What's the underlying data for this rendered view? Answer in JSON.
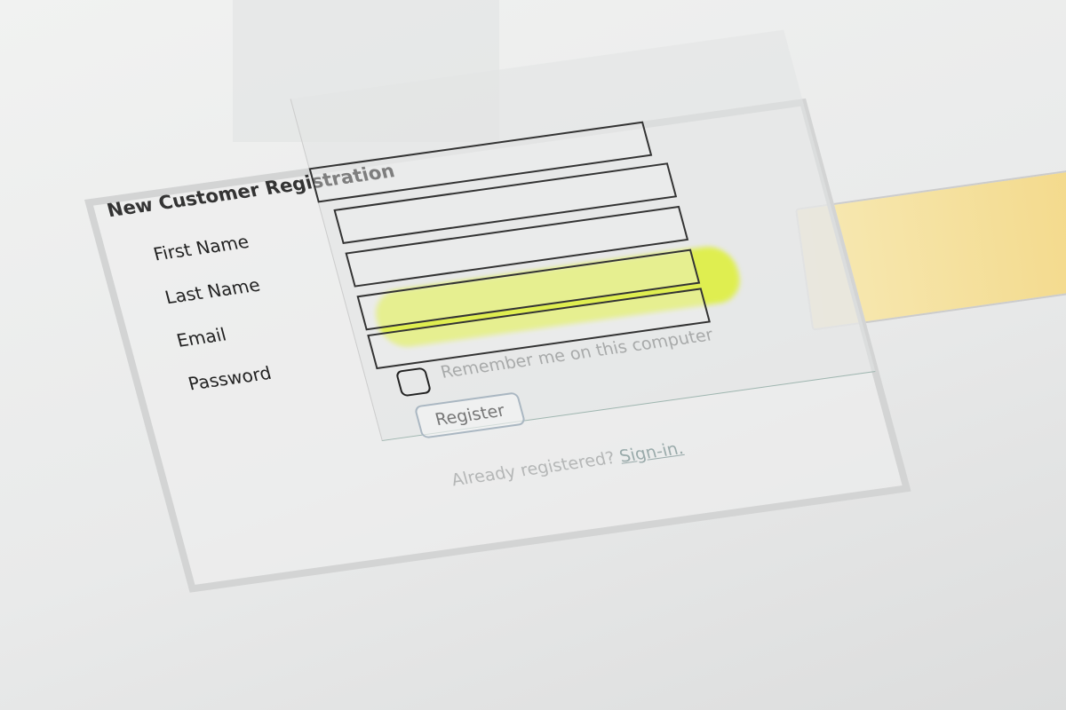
{
  "form": {
    "title": "New Customer Registration",
    "fields": [
      {
        "label": "First Name",
        "value": ""
      },
      {
        "label": "Last Name",
        "value": ""
      },
      {
        "label": "Email",
        "value": ""
      },
      {
        "label": "Password",
        "value": ""
      }
    ],
    "remember_label": "Remember me on this computer",
    "remember_checked": false,
    "register_label": "Register",
    "already_text": "Already registered?",
    "signin_link": "Sign-in."
  },
  "colors": {
    "highlighter": "#d8f02a",
    "note": "#f3d98a"
  }
}
